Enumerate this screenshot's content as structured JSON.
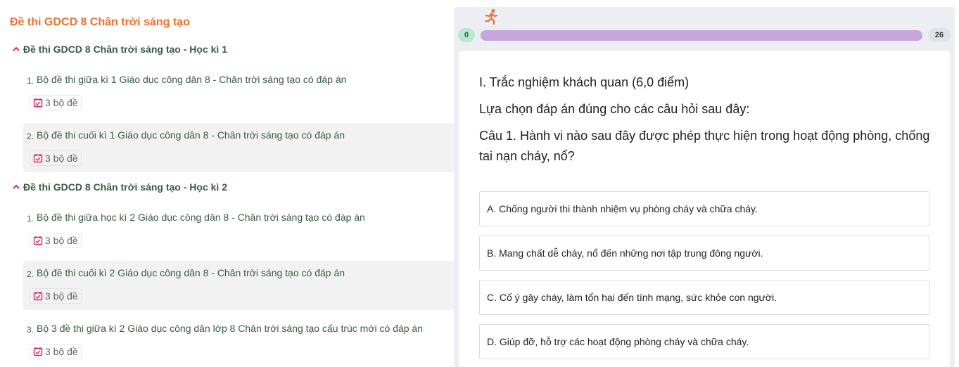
{
  "left": {
    "title": "Đề thi GDCD 8 Chân trời sáng tạo",
    "sections": [
      {
        "heading": "Đề thi GDCD 8 Chân trời sáng tạo - Học kì 1",
        "items": [
          {
            "num": "1.",
            "text": "Bộ đề thi giữa kì 1 Giáo dục công dân 8 - Chân trời sáng tạo có đáp án",
            "badge": "3 bộ đề"
          },
          {
            "num": "2.",
            "text": "Bộ đề thi cuối kì 1 Giáo dục công dân 8 - Chân trời sáng tạo có đáp án",
            "badge": "3 bộ đề"
          }
        ]
      },
      {
        "heading": "Đề thi GDCD 8 Chân trời sáng tạo - Học kì 2",
        "items": [
          {
            "num": "1.",
            "text": "Bộ đề thi giữa học kì 2 Giáo dục công dân 8 - Chân trời sáng tạo có đáp án",
            "badge": "3 bộ đề"
          },
          {
            "num": "2.",
            "text": "Bộ đề thi cuối kì 2 Giáo dục công dân 8 - Chân trời sáng tạo có đáp án",
            "badge": "3 bộ đề"
          },
          {
            "num": "3.",
            "text": "Bộ 3 đề thi giữa kì 2 Giáo dục công dân lớp 8 Chân trời sáng tạo cấu trúc mới có đáp án",
            "badge": "3 bộ đề"
          }
        ]
      }
    ]
  },
  "progress": {
    "start_label": "0",
    "end_label": "26",
    "current": 0,
    "total": 26
  },
  "quiz": {
    "section_title": "I. Trắc nghiệm khách quan (6,0 điểm)",
    "instruction": "Lựa chọn đáp án đúng cho các câu hỏi sau đây:",
    "question": "Câu 1. Hành vi nào sau đây được phép thực hiện trong hoạt động phòng, chống tai nạn cháy, nổ?",
    "options": [
      "A. Chống người thi thành nhiệm vụ phòng cháy và chữa cháy.",
      "B. Mang chất dễ cháy, nổ đến những nơi tập trung đông người.",
      "C. Cố ý gây cháy, làm tổn hại đến tính mạng, sức khỏe con người.",
      "D. Giúp đỡ, hỗ trợ các hoạt động phòng cháy và chữa cháy."
    ]
  },
  "colors": {
    "title_orange": "#f0702e",
    "heading_green": "#3b5a45",
    "accent_red": "#e0245e",
    "progress_purple": "#c6a6dc"
  },
  "icons": {
    "section_toggle": "chevron-up-icon",
    "badge": "calendar-check-icon",
    "progress_marker": "runner-icon"
  }
}
